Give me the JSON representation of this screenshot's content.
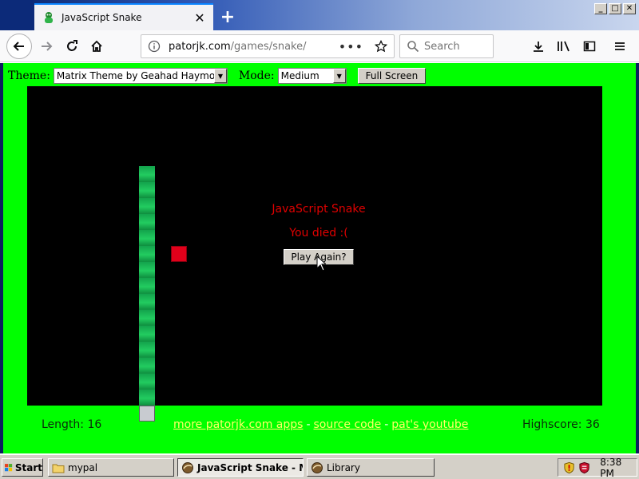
{
  "browser": {
    "tab_title": "JavaScript Snake",
    "url_host": "patorjk.com",
    "url_path": "/games/snake/",
    "search_placeholder": "Search",
    "window_controls": [
      "minimize",
      "maximize",
      "close"
    ]
  },
  "page": {
    "theme_label": "Theme:",
    "theme_value": "Matrix Theme by Geahad Haymor",
    "mode_label": "Mode:",
    "mode_value": "Medium",
    "fullscreen_label": "Full Screen",
    "game": {
      "title": "JavaScript Snake",
      "message": "You died :(",
      "play_again_label": "Play Again?"
    },
    "footer": {
      "length_text": "Length: 16",
      "links": [
        "more patorjk.com apps",
        "source code",
        "pat's youtube"
      ],
      "separator": "-",
      "highscore_text": "Highscore: 36"
    }
  },
  "taskbar": {
    "start_label": "Start",
    "items": [
      {
        "label": "mypal",
        "icon": "folder-icon"
      },
      {
        "label": "JavaScript Snake - M...",
        "icon": "browser-icon",
        "active": true
      },
      {
        "label": "Library",
        "icon": "browser-icon"
      }
    ],
    "clock": "8:38 PM"
  },
  "colors": {
    "page_bg": "#00ff00",
    "board_bg": "#000000",
    "message_text": "#e00000",
    "link_text": "#ffff66",
    "snake": "#22cc60",
    "food": "#e0001a"
  }
}
